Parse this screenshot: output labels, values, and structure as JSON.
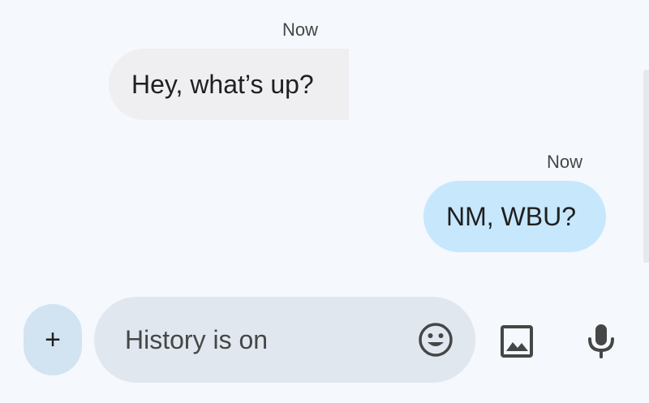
{
  "conversation": {
    "messages": [
      {
        "timestamp": "Now",
        "text": "Hey, what’s up?",
        "direction": "incoming"
      },
      {
        "timestamp": "Now",
        "text": "NM, WBU?",
        "direction": "outgoing"
      }
    ]
  },
  "compose": {
    "add_label": "+",
    "placeholder": "History is on",
    "icons": {
      "add": "plus-icon",
      "emoji": "emoji-icon",
      "attach_image": "image-icon",
      "voice": "microphone-icon"
    }
  },
  "colors": {
    "background": "#f5f8fc",
    "incoming_bubble": "#efeef1",
    "outgoing_bubble": "#c7e7fd",
    "compose_field": "#e1e7ef",
    "plus_button": "#d2e3f1",
    "icon": "#444746"
  }
}
